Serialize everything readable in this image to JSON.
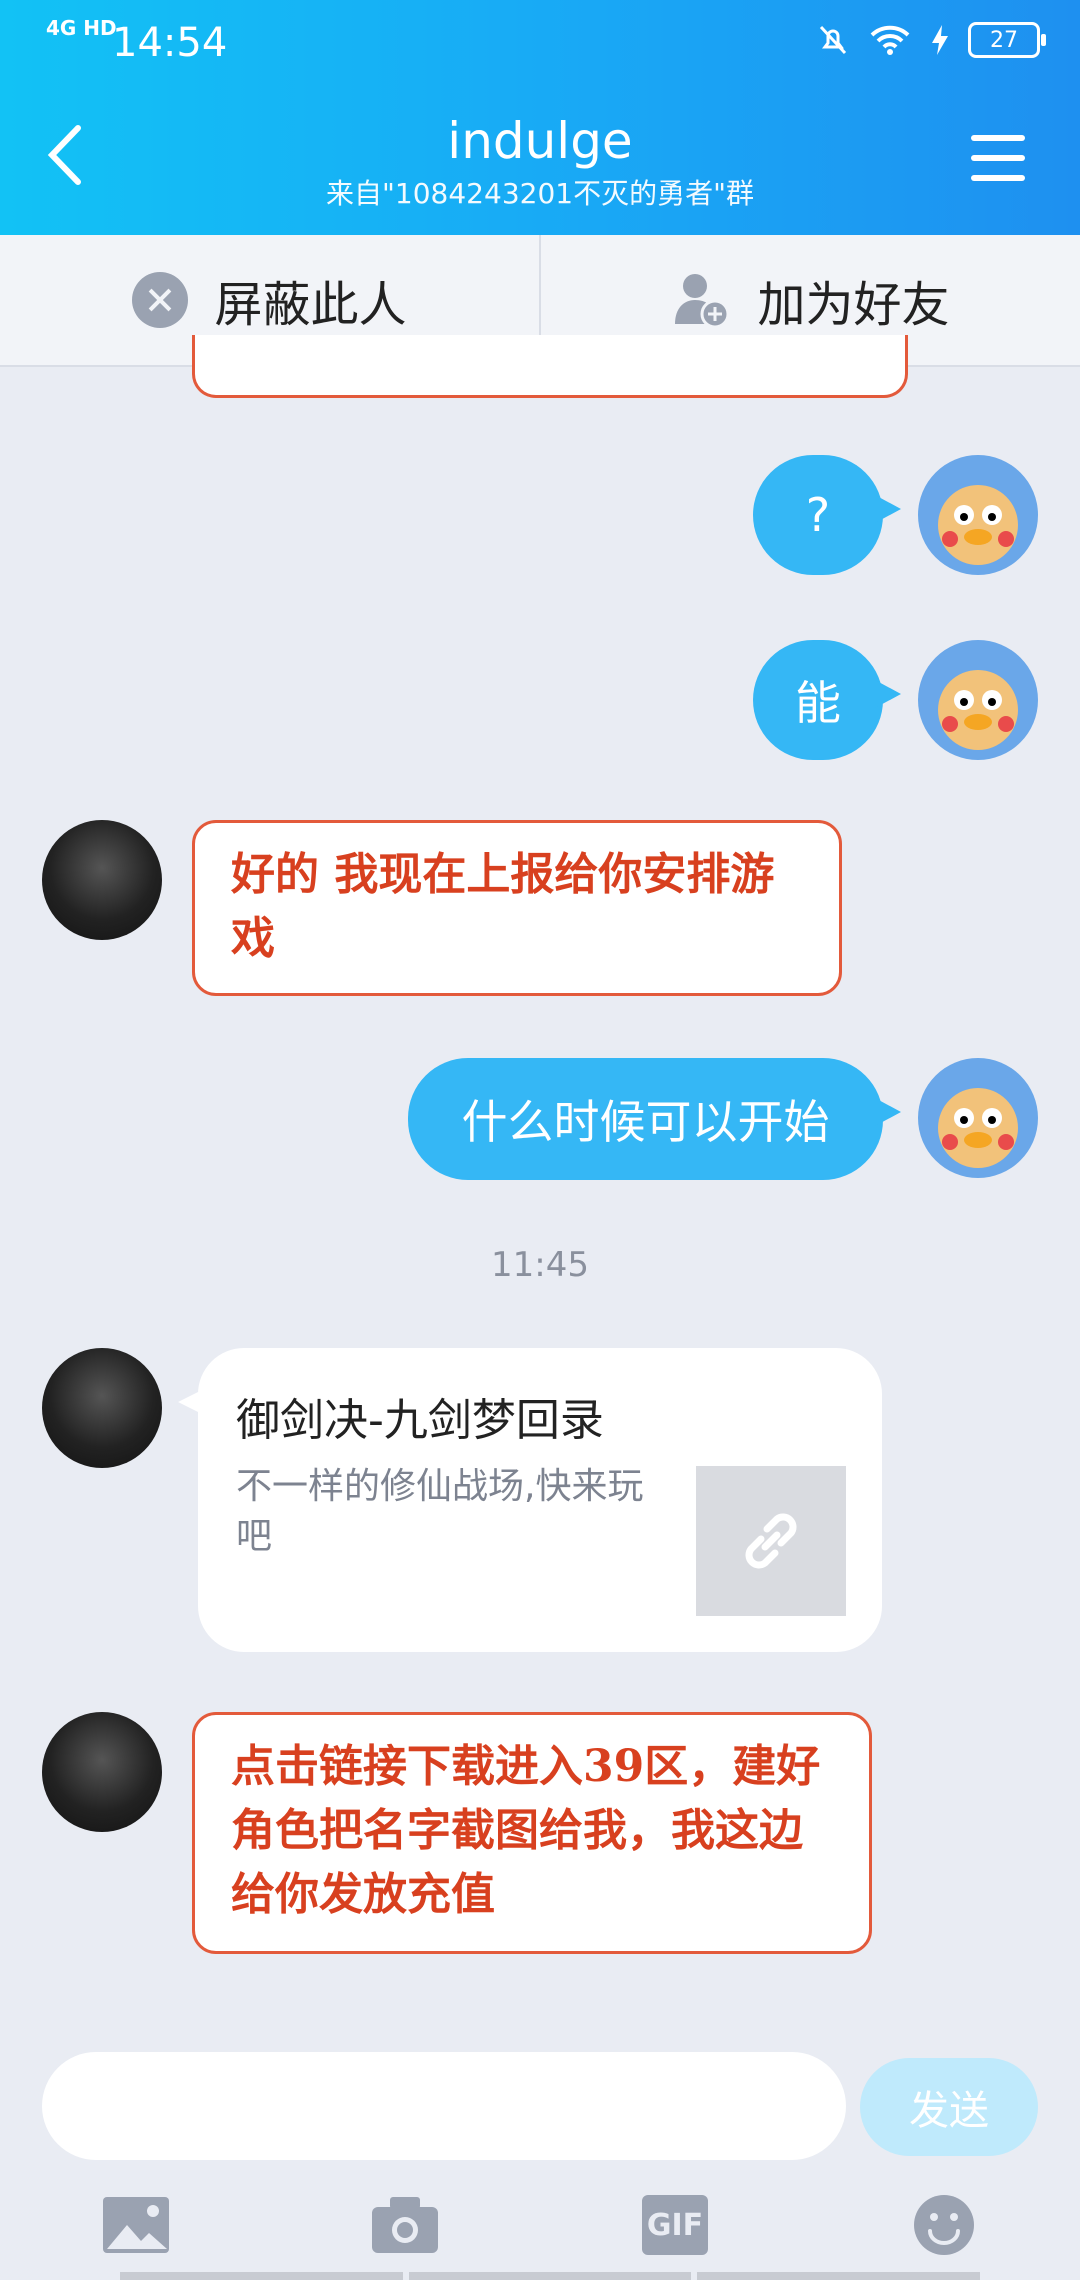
{
  "status_bar": {
    "network": "4G HD",
    "time": "14:54",
    "battery": "27"
  },
  "header": {
    "title": "indulge",
    "subtitle": "来自\"1084243201不灭的勇者\"群"
  },
  "actions": {
    "block_label": "屏蔽此人",
    "add_friend_label": "加为好友"
  },
  "messages": {
    "m1": "?",
    "m2": "能",
    "m3": "好的 我现在上报给你安排游戏",
    "m4": "什么时候可以开始",
    "time": "11:45",
    "card_title": "御剑决-九剑梦回录",
    "card_desc": "不一样的修仙战场,快来玩吧",
    "m5": "点击链接下载进入39区，建好角色把名字截图给我，我这边给你发放充值"
  },
  "input": {
    "placeholder": "",
    "send_label": "发送"
  },
  "toolbar": {
    "icons": [
      "image-icon",
      "camera-icon",
      "gif-icon",
      "emoji-icon"
    ],
    "gif_label": "GIF"
  },
  "colors": {
    "header": "#19a8f5",
    "blue_bubble": "#35b7f5",
    "red_text": "#d8401f"
  }
}
